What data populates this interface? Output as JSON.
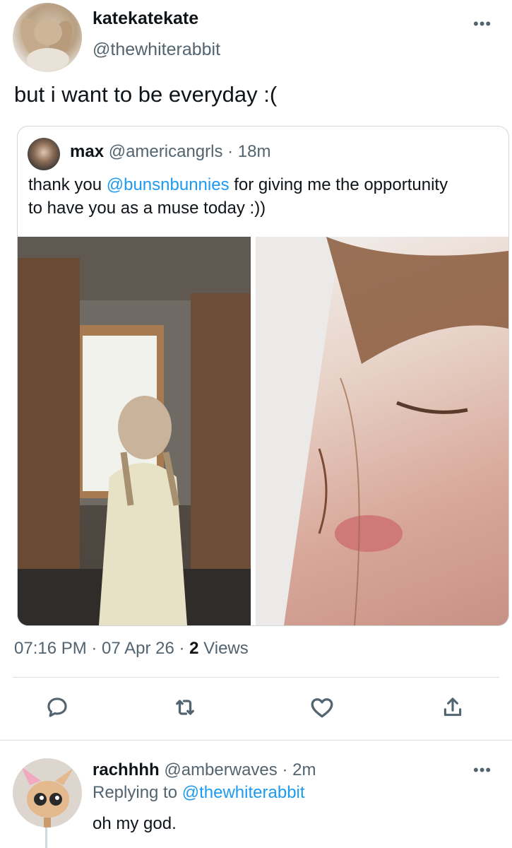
{
  "main_tweet": {
    "display_name": "katekatekate",
    "handle": "@thewhiterabbit",
    "text": "but i want to be everyday :(",
    "more_label": "•••",
    "timestamp": "07:16 PM · 07 Apr 26 · ",
    "views_count": "2",
    "views_label": " Views"
  },
  "quoted_tweet": {
    "display_name": "max",
    "handle_time": "@americangrls · 18m",
    "text_before": "thank you ",
    "mention": "@bunsnbunnies",
    "text_after": " for giving me the opportunity to have you as a muse today :))"
  },
  "actions": {
    "reply_icon": "speech-bubble",
    "retweet_icon": "retweet-arrows",
    "like_icon": "heart-outline",
    "share_icon": "share-up-arrow"
  },
  "reply": {
    "display_name": "rachhhh",
    "handle_time": " @amberwaves · 2m",
    "replying_prefix": "Replying to ",
    "replying_to": "@thewhiterabbit",
    "text": "oh my god.",
    "more_label": "•••"
  }
}
